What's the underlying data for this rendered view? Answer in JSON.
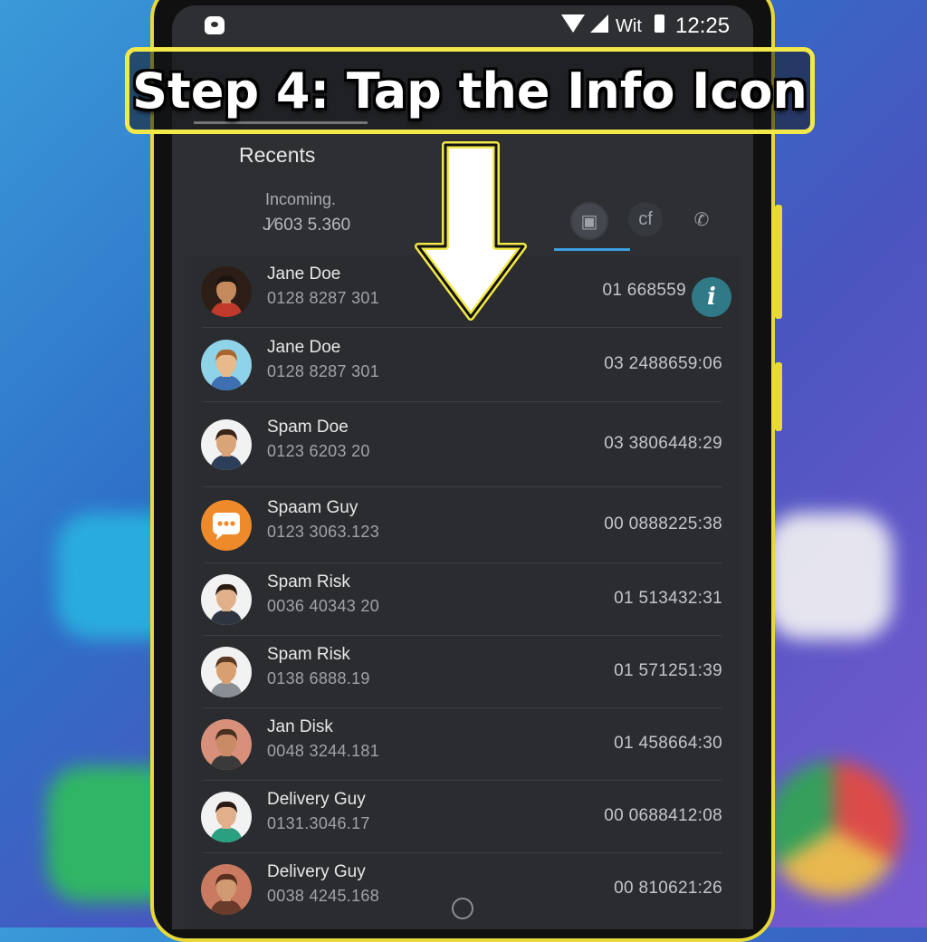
{
  "status_bar": {
    "carrier": "Wit",
    "time": "12:25"
  },
  "screen_header": {
    "title": "Recents",
    "subtitle": "Incoming.",
    "number": "J⁄603 5.360",
    "filter_icons": [
      "instagram-icon",
      "facebook-icon",
      "phone-icon"
    ],
    "filter_icon_glyphs": [
      "▣",
      "cf",
      "✆"
    ]
  },
  "annotation": {
    "step_text": "Step 4: Tap the Info Icon",
    "highlight_color": "#f2e84a"
  },
  "calls": [
    {
      "name": "Jane Doe",
      "number": "0128 8287 301",
      "time": "01 668559",
      "avatar_bg": "#2c1e16",
      "skin": "#c48a5e",
      "hair": "#1c1410",
      "shirt": "#c0392b",
      "has_info": true
    },
    {
      "name": "Jane Doe",
      "number": "0128 8287 301",
      "time": "03 2488659:06",
      "avatar_bg": "#8fd3e8",
      "skin": "#e8b98a",
      "hair": "#a8652e",
      "shirt": "#3e6fb0",
      "has_info": false
    },
    {
      "name": "Spam Doe",
      "number": "0123 6203 20",
      "time": "03 3806448:29",
      "avatar_bg": "#f2f2f2",
      "skin": "#d9a478",
      "hair": "#3a2418",
      "shirt": "#2c3e5a",
      "has_info": false
    },
    {
      "name": "Spaam Guy",
      "number": "0123 3063.123",
      "time": "00 0888225:38",
      "avatar_bg": "#ee8a2a",
      "skin": "",
      "hair": "",
      "shirt": "",
      "has_info": false
    },
    {
      "name": "Spam Risk",
      "number": "0036 40343 20",
      "time": "01 513432:31",
      "avatar_bg": "#f2f2f2",
      "skin": "#e0b08a",
      "hair": "#2a1c14",
      "shirt": "#2e3440",
      "has_info": false
    },
    {
      "name": "Spam Risk",
      "number": "0138 6888.19",
      "time": "01 571251:39",
      "avatar_bg": "#f2f2f2",
      "skin": "#d8a070",
      "hair": "#5a3a22",
      "shirt": "#8a8f96",
      "has_info": false
    },
    {
      "name": "Jan Disk",
      "number": "0048 3244.181",
      "time": "01 458664:30",
      "avatar_bg": "#d9907a",
      "skin": "#c98a66",
      "hair": "#4a2e20",
      "shirt": "#3a3a3a",
      "has_info": false
    },
    {
      "name": "Delivery Guy",
      "number": "0131.3046.17",
      "time": "00 0688412:08",
      "avatar_bg": "#f2f2f2",
      "skin": "#e0b08a",
      "hair": "#2a1c14",
      "shirt": "#2aa080",
      "has_info": false
    },
    {
      "name": "Delivery Guy",
      "number": "0038 4245.168",
      "time": "00 810621:26",
      "avatar_bg": "#c97a60",
      "skin": "#d09a72",
      "hair": "#5a2e1e",
      "shirt": "#6a3a2a",
      "has_info": false
    }
  ]
}
